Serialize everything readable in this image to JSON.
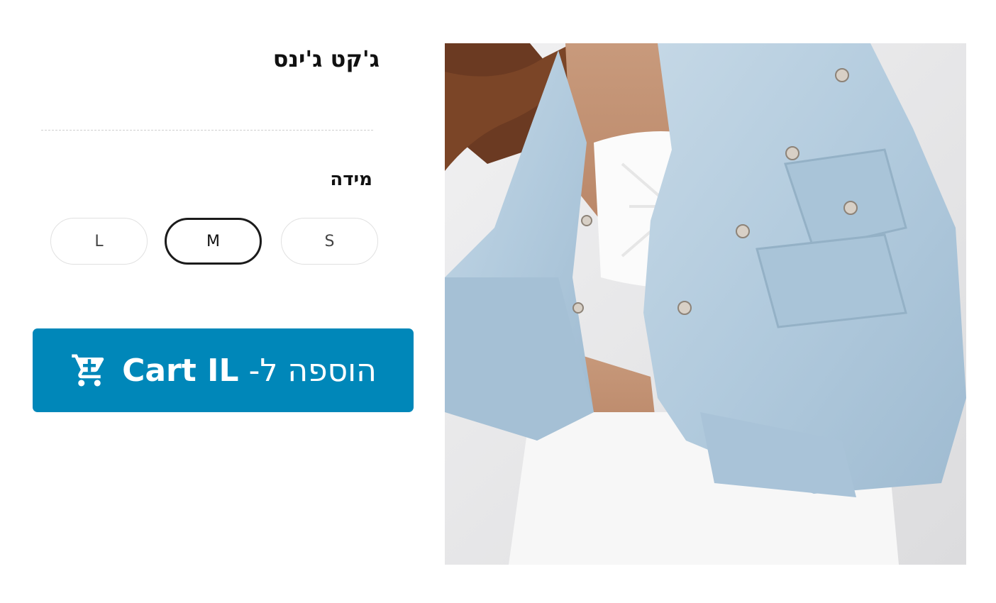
{
  "product": {
    "title": "ג'קט ג'ינס"
  },
  "size_selector": {
    "label": "מידה",
    "options": [
      "S",
      "M",
      "L"
    ],
    "selected": "M"
  },
  "cart_button": {
    "text_prefix": "הוספה ל-",
    "brand": "Cart IL",
    "icon": "shopping-cart-icon"
  },
  "colors": {
    "cta_background": "#0087b9",
    "selected_border": "#1b1b1b",
    "denim": "#b7cfe0"
  }
}
